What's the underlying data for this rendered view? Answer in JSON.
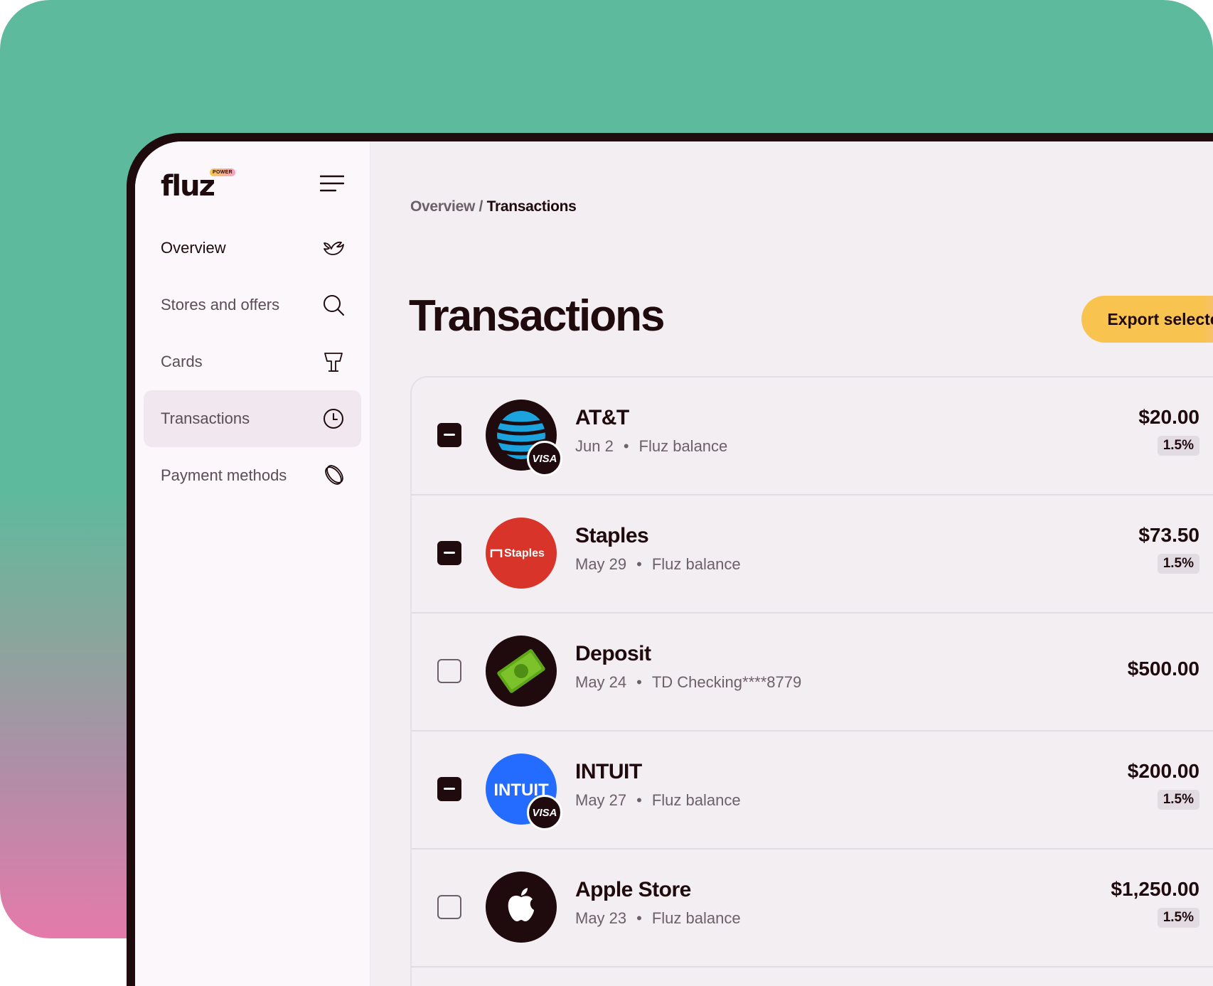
{
  "app": {
    "logo_text": "fluz",
    "logo_badge": "POWER"
  },
  "sidebar": {
    "items": [
      {
        "label": "Overview",
        "icon": "dove-icon"
      },
      {
        "label": "Stores and offers",
        "icon": "search-icon"
      },
      {
        "label": "Cards",
        "icon": "card-stand-icon"
      },
      {
        "label": "Transactions",
        "icon": "clock-icon",
        "active": true
      },
      {
        "label": "Payment methods",
        "icon": "coin-icon"
      }
    ]
  },
  "breadcrumb": {
    "parent": "Overview",
    "separator": " / ",
    "current": "Transactions"
  },
  "page": {
    "title": "Transactions",
    "export_label": "Export selected"
  },
  "transactions": [
    {
      "merchant": "AT&T",
      "date": "Jun 2",
      "method": "Fluz balance",
      "amount": "$20.00",
      "cashback": "1.5%",
      "checked": true,
      "visa": "VISA",
      "logo": "att-logo"
    },
    {
      "merchant": "Staples",
      "date": "May 29",
      "method": "Fluz balance",
      "amount": "$73.50",
      "cashback": "1.5%",
      "checked": true,
      "logo_text": "Staples",
      "logo": "staples-logo"
    },
    {
      "merchant": "Deposit",
      "date": "May 24",
      "method": "TD Checking****8779",
      "amount": "$500.00",
      "checked": false,
      "logo": "deposit-logo"
    },
    {
      "merchant": "INTUIT",
      "date": "May 27",
      "method": "Fluz balance",
      "amount": "$200.00",
      "cashback": "1.5%",
      "checked": true,
      "visa": "VISA",
      "logo_text": "INTUIT",
      "logo": "intuit-logo"
    },
    {
      "merchant": "Apple Store",
      "date": "May 23",
      "method": "Fluz balance",
      "amount": "$1,250.00",
      "cashback": "1.5%",
      "checked": false,
      "logo": "apple-logo"
    }
  ],
  "colors": {
    "background_top": "#5dba9d",
    "background_bottom": "#e57aaa",
    "ink": "#1f0a0d",
    "export_button": "#f8c44f",
    "staples_red": "#d8342a",
    "intuit_blue": "#236cff",
    "att_blue": "#1aa3dd"
  }
}
